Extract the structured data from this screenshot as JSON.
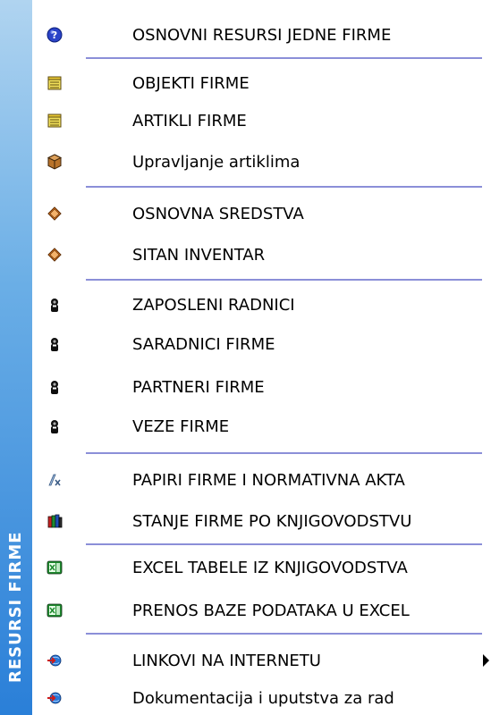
{
  "sidebar": {
    "title": "RESURSI FIRME",
    "colors": {
      "strip_top": "#b0d4f0",
      "strip_bottom": "#2a7fd8"
    }
  },
  "menu": {
    "items": [
      {
        "label": "OSNOVNI RESURSI JEDNE FIRME",
        "icon": "help-icon"
      },
      {
        "label": "OBJEKTI FIRME",
        "icon": "folder-notepad-icon"
      },
      {
        "label": "ARTIKLI FIRME",
        "icon": "folder-notepad-icon"
      },
      {
        "label": "Upravljanje artiklima",
        "icon": "box-icon"
      },
      {
        "label": "OSNOVNA SREDSTVA",
        "icon": "book-icon"
      },
      {
        "label": "SITAN INVENTAR",
        "icon": "book-icon"
      },
      {
        "label": "ZAPOSLENI RADNICI",
        "icon": "person-icon"
      },
      {
        "label": "SARADNICI FIRME",
        "icon": "person-icon"
      },
      {
        "label": "PARTNERI FIRME",
        "icon": "person-icon"
      },
      {
        "label": "VEZE FIRME",
        "icon": "person-icon"
      },
      {
        "label": "PAPIRI FIRME I NORMATIVNA AKTA",
        "icon": "formula-icon"
      },
      {
        "label": "STANJE FIRME PO KNJIGOVODSTVU",
        "icon": "books-icon"
      },
      {
        "label": "EXCEL TABELE IZ KNJIGOVODSTVA",
        "icon": "excel-icon"
      },
      {
        "label": "PRENOS BAZE PODATAKA U EXCEL",
        "icon": "excel-icon"
      },
      {
        "label": "LINKOVI NA INTERNETU",
        "icon": "link-icon",
        "submenu": true
      },
      {
        "label": "Dokumentacija i uputstva za rad",
        "icon": "link-icon"
      }
    ]
  }
}
